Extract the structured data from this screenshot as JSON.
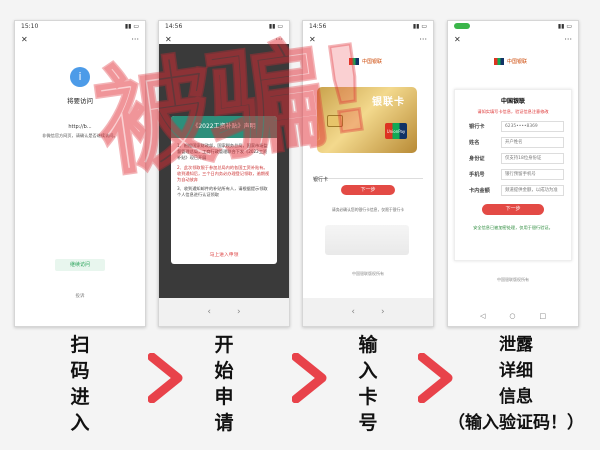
{
  "phone1": {
    "time": "15:10",
    "close": "✕",
    "heading": "将要访问",
    "url": "http://b...",
    "warning": "非微信官方网页，请确认是否继续访问。",
    "continue_label": "继续访问",
    "complain": "投诉"
  },
  "phone2": {
    "time": "14:56",
    "close": "✕",
    "modal_title": "《2022工资补贴》声明",
    "items": [
      "1、根据国家财政部，国家税务总局，国家市场监督管理总局，工商行政管理联合下发《2022工资补贴》现已开展",
      "2、此次领取限于参加总局内的各国工资补贴有。收到通知后，三个日内务必办理登记领取，逾期视为自动放弃",
      "3、收到通知邮件的补贴所有人，请根据提示领取个人信息进行认证领取"
    ],
    "modal_button": "马上进入申领",
    "nav_back": "‹",
    "nav_forward": "›"
  },
  "phone3": {
    "time": "14:56",
    "close": "✕",
    "brand": "中国银联",
    "card_title": "银联卡",
    "card_badge": "UnionPay",
    "input_label": "银行卡",
    "next_label": "下一步",
    "note": "请务必确认您的银行卡信息，仅限于银行卡",
    "footer": "中国银联版权所有",
    "nav_back": "‹",
    "nav_forward": "›"
  },
  "phone4": {
    "close": "✕",
    "brand": "中国银联",
    "form_title": "中国银联",
    "form_note": "请如实填写卡信息，验证信息注意修改",
    "rows": [
      {
        "label": "银行卡",
        "value": "6235••••8369"
      },
      {
        "label": "姓名",
        "value": "开户姓名"
      },
      {
        "label": "身份证",
        "value": "仅支持18位身份证"
      },
      {
        "label": "手机号",
        "value": "银行预留手机号"
      },
      {
        "label": "卡内金额",
        "value": "频道提供金额，以成功为准"
      }
    ],
    "next_label": "下一步",
    "safety": "安全信息已被加密处理，仅用于银行验证。",
    "footer": "中国银联版权所有"
  },
  "watermark": "被骗!",
  "steps": [
    {
      "text": "扫\n码\n进\n入"
    },
    {
      "text": "开\n始\n申\n请"
    },
    {
      "text": "输\n入\n卡\n号"
    },
    {
      "text": "泄露\n详细\n信息\n（输入验证码！）"
    }
  ],
  "colors": {
    "arrow": "#e8424a",
    "brand_red": "#e34a45",
    "modal_header": "#2d8f7b"
  }
}
